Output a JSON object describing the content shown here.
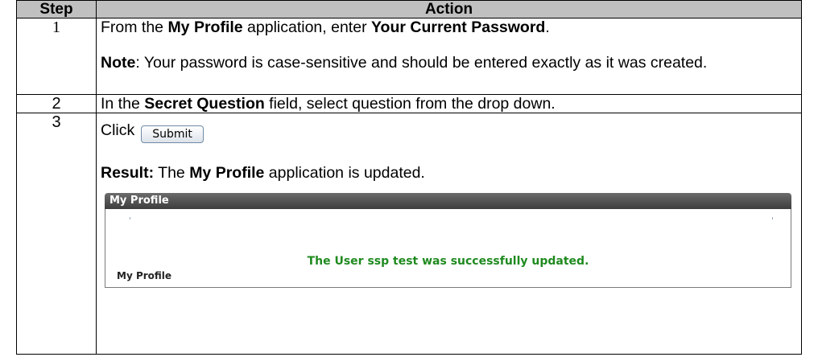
{
  "table": {
    "header": {
      "step": "Step",
      "action": "Action"
    },
    "rows": [
      {
        "step": "1",
        "line1": {
          "t1": "From the ",
          "b1": "My Profile",
          "t2": " application, enter ",
          "b2": "Your Current Password",
          "t3": "."
        },
        "note": {
          "b": "Note",
          "t": ":  Your password is case-sensitive and should be entered exactly as it was created."
        }
      },
      {
        "step": "2",
        "line": {
          "t1": "In the ",
          "b1": "Secret Question",
          "t2": " field, select question from the drop down."
        }
      },
      {
        "step": "3",
        "click_text": "Click",
        "button_label": "Submit",
        "result": {
          "b1": "Result:",
          "t1": "  The ",
          "b2": "My Profile",
          "t2": " application is updated."
        },
        "screenshot": {
          "header": "My Profile",
          "message": "The User ssp test was successfully updated.",
          "subheading": "My Profile"
        }
      }
    ]
  },
  "colors": {
    "header_bg": "#c0c0c0",
    "success_text": "#1f8a1f"
  }
}
